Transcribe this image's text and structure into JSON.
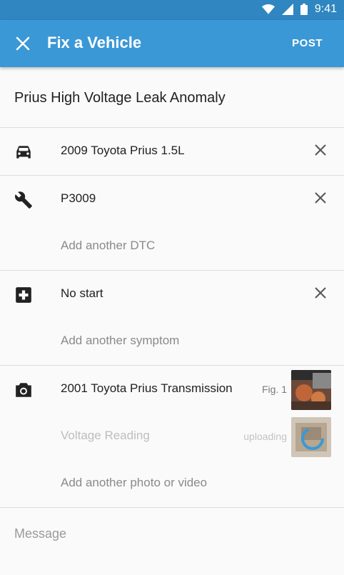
{
  "status": {
    "time": "9:41"
  },
  "appbar": {
    "title": "Fix a Vehicle",
    "post_label": "POST"
  },
  "fix_title": "Prius High Voltage Leak Anomaly",
  "vehicle": {
    "name": "2009 Toyota Prius 1.5L",
    "icon": "car-icon"
  },
  "dtc": {
    "code": "P3009",
    "add_label": "Add another DTC",
    "icon": "wrench-icon"
  },
  "symptom": {
    "name": "No start",
    "add_label": "Add another symptom",
    "icon": "medical-plus-icon"
  },
  "media": {
    "icon": "camera-icon",
    "items": [
      {
        "caption": "2001 Toyota Prius Transmission",
        "tag": "Fig. 1"
      },
      {
        "caption": "Voltage Reading",
        "tag": "uploading"
      }
    ],
    "add_label": "Add another photo or video"
  },
  "message": {
    "placeholder": "Message"
  },
  "colors": {
    "appbar": "#3b98d6",
    "statusbar": "#2f86c0"
  }
}
